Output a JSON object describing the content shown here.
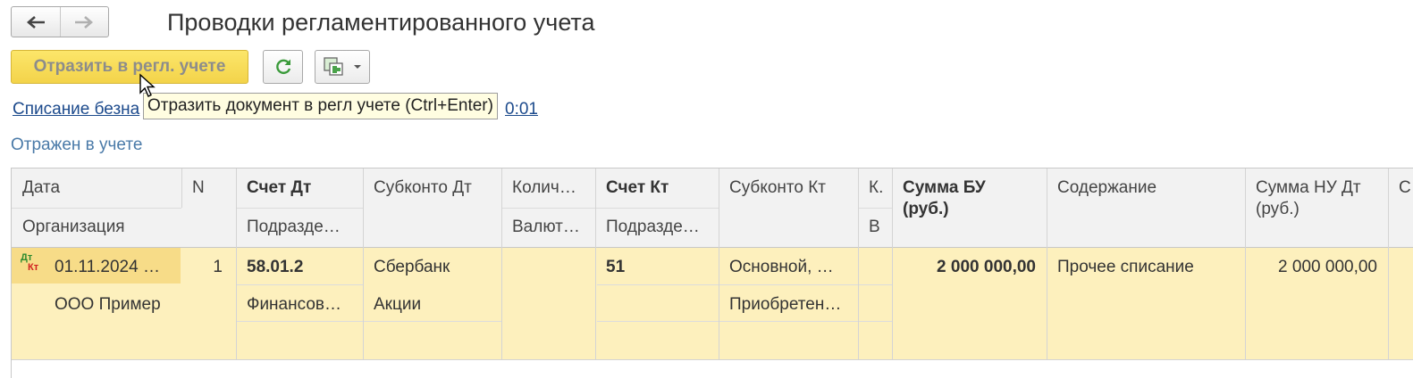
{
  "window": {
    "title": "Проводки регламентированного учета"
  },
  "nav": {
    "back_icon": "arrow-left-icon",
    "forward_icon": "arrow-right-icon"
  },
  "toolbar": {
    "reflect_label": "Отразить в регл. учете",
    "refresh_icon": "refresh-icon",
    "menu_icon": "document-structure-icon"
  },
  "document": {
    "link_start": "Списание безна",
    "link_end": "0:01"
  },
  "tooltip": {
    "text": "Отразить документ в регл учете (Ctrl+Enter)"
  },
  "status": {
    "text": "Отражен в учете"
  },
  "colors": {
    "selected_row": "#fdf0bd",
    "button_yellow": "#f5d84f",
    "link": "#1c4a8c"
  },
  "table": {
    "headers": {
      "date": "Дата",
      "org": "Организация",
      "n": "N",
      "acc_dt": "Счет Дт",
      "dept_dt": "Подразде…",
      "subconto_dt": "Субконто Дт",
      "qty": "Колич…",
      "currency": "Валют…",
      "acc_kt": "Счет Кт",
      "dept_kt": "Подразде…",
      "subconto_kt": "Субконто Кт",
      "k": "К.",
      "v": "В",
      "sum_bu_1": "Сумма БУ",
      "sum_bu_2": "(руб.)",
      "content": "Содержание",
      "sum_nu_1": "Сумма НУ Дт",
      "sum_nu_2": "(руб.)",
      "last": "С"
    },
    "rows": [
      {
        "type_icon_dt": "Дт",
        "type_icon_kt": "Кт",
        "date": "01.11.2024 …",
        "org": "ООО Пример",
        "n": "1",
        "acc_dt": "58.01.2",
        "dept_dt": "Финансов…",
        "subconto_dt_1": "Сбербанк",
        "subconto_dt_2": "Акции",
        "acc_kt": "51",
        "subconto_kt_1": "Основной, …",
        "subconto_kt_2": "Приобретен…",
        "sum_bu": "2 000 000,00",
        "content": "Прочее списание",
        "sum_nu": "2 000 000,00"
      }
    ]
  }
}
